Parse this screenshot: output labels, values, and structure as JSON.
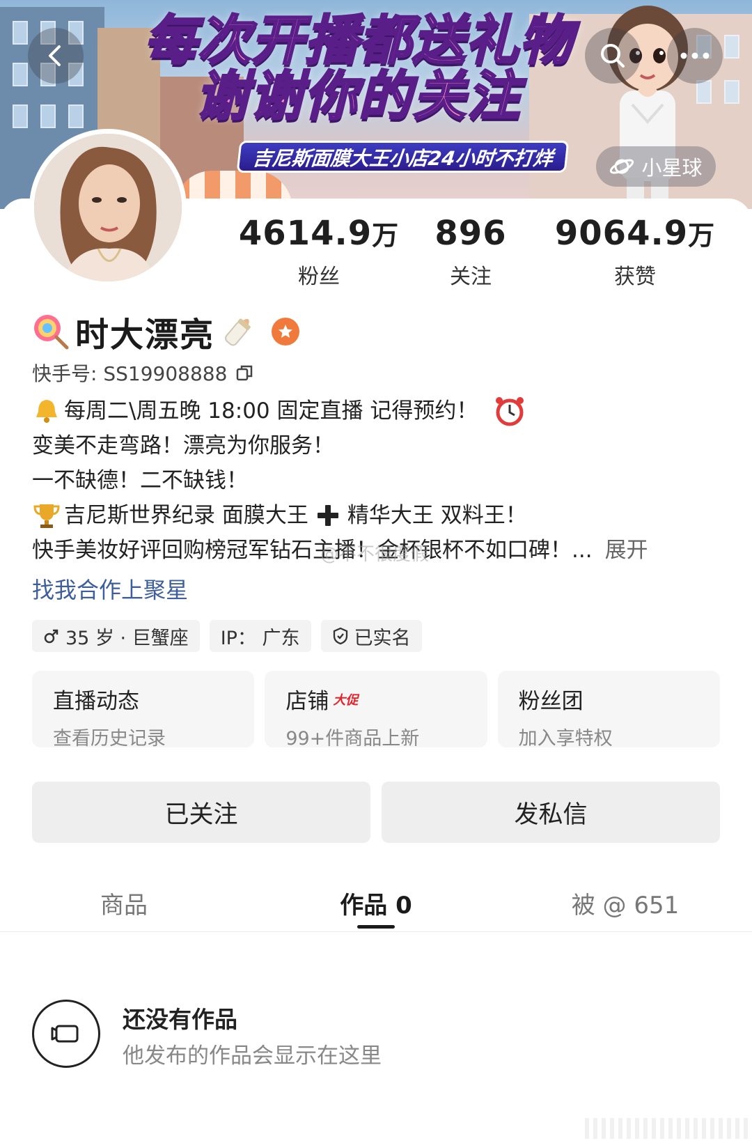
{
  "banner": {
    "title_line1": "每次开播都送礼物",
    "title_line2": "谢谢你的关注",
    "subtitle": "吉尼斯面膜大王小店24小时不打烊",
    "planet_label": "小星球"
  },
  "nav": {
    "back_icon": "chevron-left-icon",
    "search_icon": "search-icon",
    "more_icon": "more-horizontal-icon"
  },
  "stats": [
    {
      "number": "4614.9",
      "unit": "万",
      "label": "粉丝"
    },
    {
      "number": "896",
      "unit": "",
      "label": "关注"
    },
    {
      "number": "9064.9",
      "unit": "万",
      "label": "获赞"
    }
  ],
  "profile": {
    "name": "时大漂亮",
    "uid_label": "快手号: SS19908888",
    "bio": [
      "每周二\\周五晚 18:00 固定直播 记得预约！",
      "变美不走弯路！漂亮为你服务！",
      "一不缺德！二不缺钱！",
      "吉尼斯世界纪录 面膜大王",
      "精华大王 双料王！",
      "快手美妆好评回购榜冠军钻石主播！金杯银杯不如口碑！..."
    ],
    "expand_label": "展开",
    "link_text": "找我合作上聚星"
  },
  "tags": [
    {
      "icon": "male-icon",
      "text": "35 岁 · 巨蟹座"
    },
    {
      "icon": "",
      "text": "IP：  广东"
    },
    {
      "icon": "shield-check-icon",
      "text": "已实名"
    }
  ],
  "quick_cards": [
    {
      "title": "直播动态",
      "badge": "",
      "subtitle": "查看历史记录"
    },
    {
      "title": "店铺",
      "badge": "大促",
      "subtitle": "99+件商品上新"
    },
    {
      "title": "粉丝团",
      "badge": "",
      "subtitle": "加入享特权"
    }
  ],
  "actions": {
    "follow_label": "已关注",
    "message_label": "发私信"
  },
  "tabs": [
    {
      "label": "商品"
    },
    {
      "label": "作品 0"
    },
    {
      "label": "被 @ 651"
    }
  ],
  "empty_state": {
    "title": "还没有作品",
    "subtitle": "他发布的作品会显示在这里"
  },
  "watermark": "@不不很度假",
  "colors": {
    "link": "#3d5e9b",
    "badge_orange": "#f07a3c",
    "promo_red": "#e6232b"
  }
}
